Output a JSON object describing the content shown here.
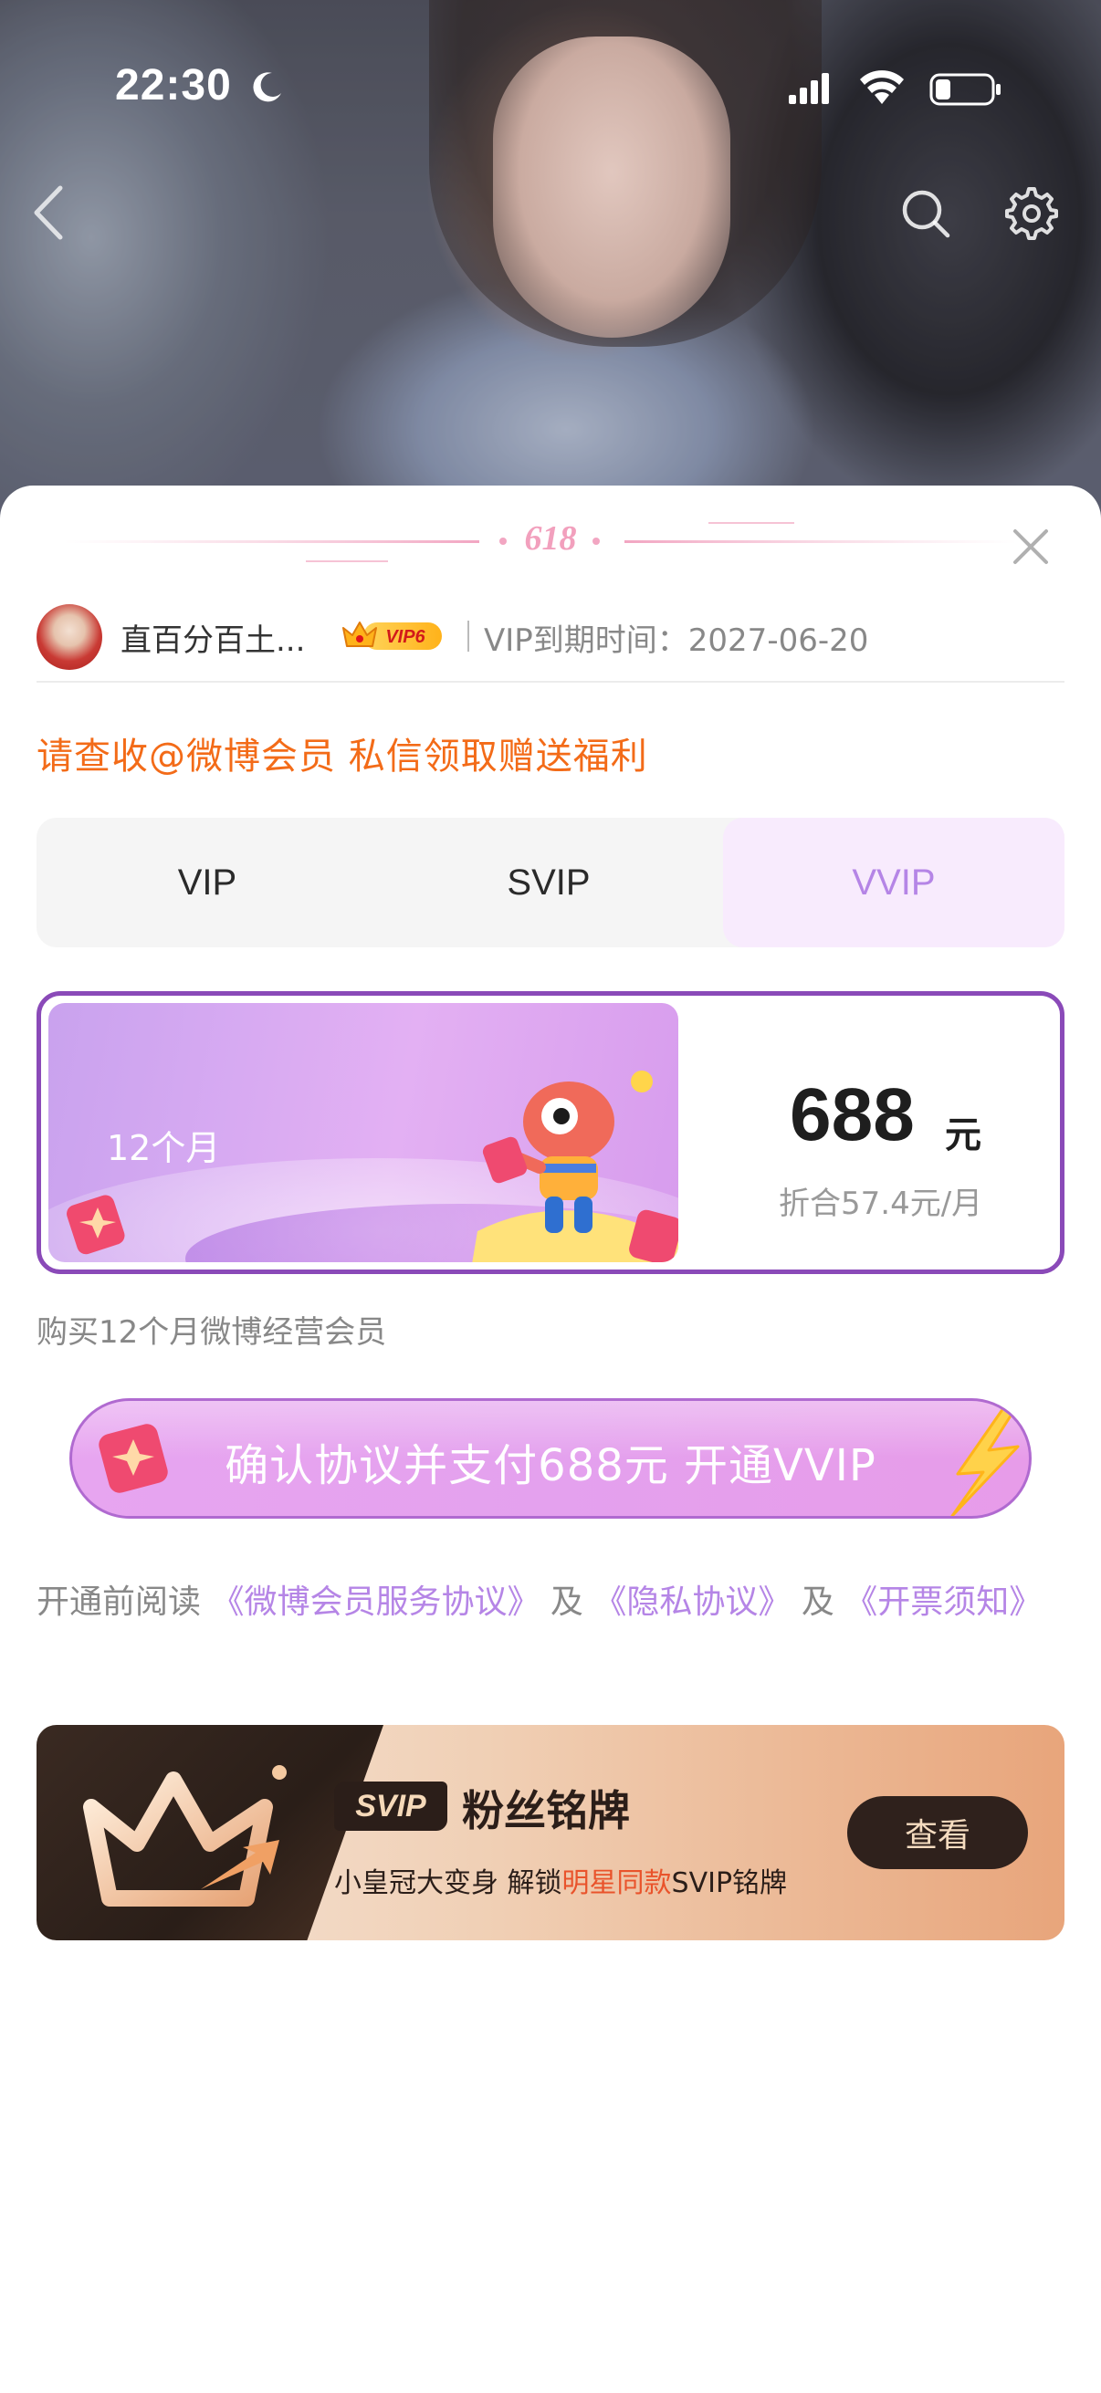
{
  "status_bar": {
    "time": "22:30"
  },
  "header": {
    "back_icon": "chevron-left-icon",
    "search_icon": "search-icon",
    "settings_icon": "gear-icon"
  },
  "sheet": {
    "banner_label": "618",
    "user": {
      "name": "直百分百土...",
      "vip_badge": "VIP6",
      "expiry": "VIP到期时间：2027-06-20"
    },
    "notice": "请查收@微博会员 私信领取赠送福利",
    "tabs": [
      {
        "label": "VIP",
        "selected": false
      },
      {
        "label": "SVIP",
        "selected": false
      },
      {
        "label": "VVIP",
        "selected": true
      }
    ],
    "plan": {
      "duration": "12个月",
      "price": "688",
      "unit": "元",
      "per_month": "折合57.4元/月"
    },
    "plan_desc": "购买12个月微博经营会员",
    "pay_button": "确认协议并支付688元 开通VVIP",
    "agreement": {
      "prefix": "开通前阅读 ",
      "link1": "《微博会员服务协议》",
      "sep1": " 及 ",
      "link2": "《隐私协议》",
      "sep2": " 及 ",
      "link3": "《开票须知》"
    },
    "promo": {
      "tag": "SVIP",
      "title": "粉丝铭牌",
      "subtitle_pre": "小皇冠大变身 解锁",
      "subtitle_hl": "明星同款",
      "subtitle_post": "SVIP铭牌",
      "button": "查看"
    }
  },
  "colors": {
    "accent_purple": "#b585e6",
    "notice_orange": "#f36b18",
    "card_border": "#8a4ab8",
    "promo_highlight": "#e9532b"
  }
}
